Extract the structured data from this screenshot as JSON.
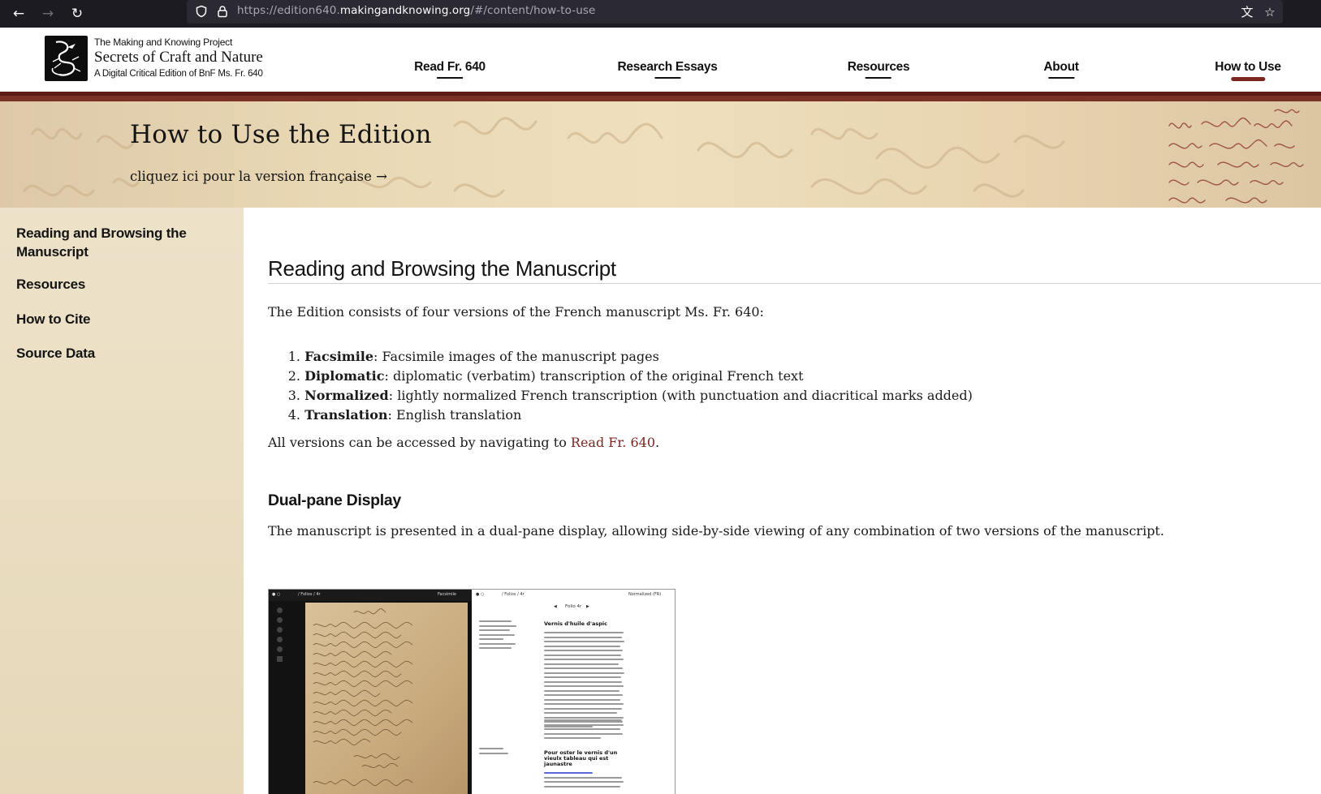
{
  "browser": {
    "url_prefix": "https://edition640.",
    "url_host": "makingandknowing.org",
    "url_path": "/#/content/how-to-use"
  },
  "header": {
    "project_name": "The Making and Knowing Project",
    "site_title": "Secrets of Craft and Nature",
    "subtitle": "A Digital Critical Edition of BnF Ms. Fr. 640",
    "nav": [
      {
        "label": "Read Fr. 640"
      },
      {
        "label": "Research Essays"
      },
      {
        "label": "Resources"
      },
      {
        "label": "About"
      },
      {
        "label": "How to Use"
      }
    ],
    "active_nav": "How to Use",
    "accent_color": "#7b2621"
  },
  "banner": {
    "title": "How to Use the Edition",
    "french_link": "cliquez ici pour la version française →"
  },
  "sidebar": {
    "items": [
      {
        "label": "Reading and Browsing the Manuscript"
      },
      {
        "label": "Resources"
      },
      {
        "label": "How to Cite"
      },
      {
        "label": "Source Data"
      }
    ]
  },
  "content": {
    "section_title": "Reading and Browsing the Manuscript",
    "intro": "The Edition consists of four versions of the French manuscript Ms. Fr. 640:",
    "versions": [
      {
        "num": "1.",
        "term": "Facsimile",
        "desc": ": Facsimile images of the manuscript pages"
      },
      {
        "num": "2.",
        "term": "Diplomatic",
        "desc": ": diplomatic (verbatim) transcription of the original French text"
      },
      {
        "num": "3.",
        "term": "Normalized",
        "desc": ": lightly normalized French transcription (with punctuation and diacritical marks added)"
      },
      {
        "num": "4.",
        "term": "Translation",
        "desc": ": English translation"
      }
    ],
    "access_text": "All versions can be accessed by navigating to ",
    "access_link": "Read Fr. 640",
    "access_end": ".",
    "dual_title": "Dual-pane Display",
    "dual_text": "The manuscript is presented in a dual-pane display, allowing side-by-side viewing of any combination of two versions of the manuscript."
  },
  "figure": {
    "left_mode": "Facsimile",
    "left_folio": "/ Folios / 4r",
    "right_mode": "Normalized (FR)",
    "right_folio": "/ Folios / 4r",
    "folio_label": "Folio 4r",
    "heading1": "Vernis d'huile d'aspic",
    "heading2": "Pour oster le vernis d'un vieulx tableau qui est jaunastre"
  }
}
